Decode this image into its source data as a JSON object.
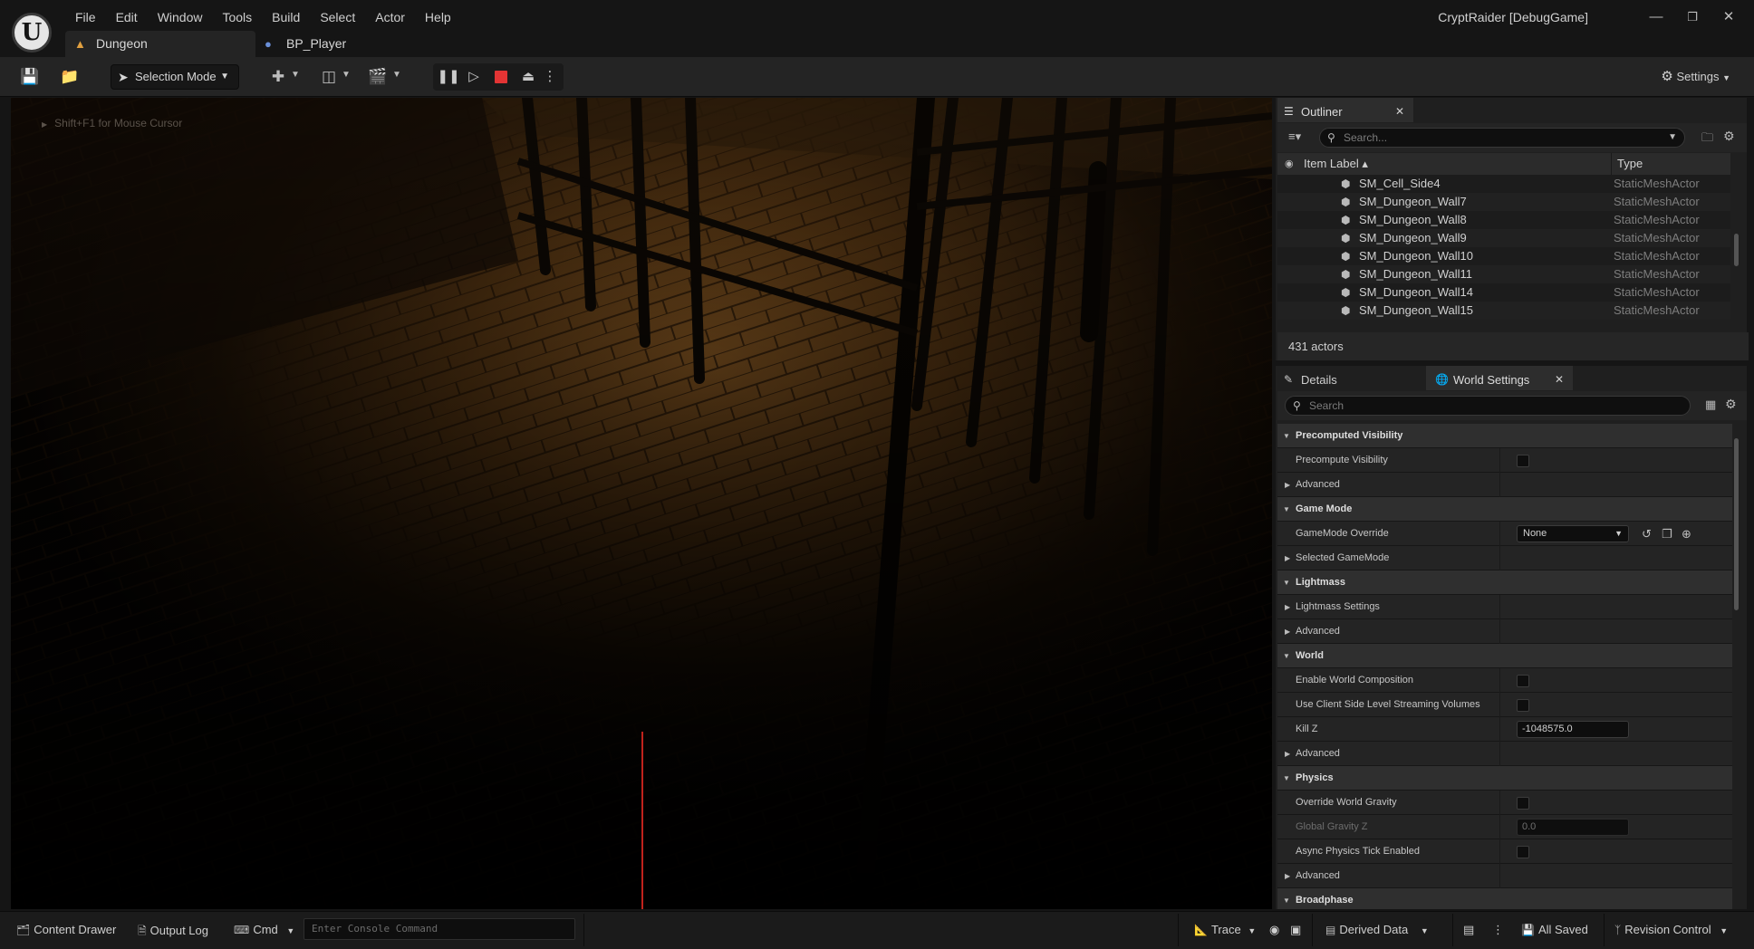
{
  "app": {
    "window_title": "CryptRaider [DebugGame]",
    "logo_glyph": "U"
  },
  "menu": [
    "File",
    "Edit",
    "Window",
    "Tools",
    "Build",
    "Select",
    "Actor",
    "Help"
  ],
  "doc_tabs": [
    {
      "label": "Dungeon",
      "icon": "level-icon",
      "active": true
    },
    {
      "label": "BP_Player",
      "icon": "blueprint-icon",
      "active": false
    }
  ],
  "toolbar": {
    "mode_label": "Selection Mode",
    "settings_label": "Settings"
  },
  "viewport": {
    "hint": "Shift+F1 for Mouse Cursor"
  },
  "outliner": {
    "tab_label": "Outliner",
    "search_placeholder": "Search...",
    "col_label": "Item Label ▴",
    "col_type": "Type",
    "rows": [
      {
        "label": "SM_Cell_Side4",
        "type": "StaticMeshActor"
      },
      {
        "label": "SM_Dungeon_Wall7",
        "type": "StaticMeshActor"
      },
      {
        "label": "SM_Dungeon_Wall8",
        "type": "StaticMeshActor"
      },
      {
        "label": "SM_Dungeon_Wall9",
        "type": "StaticMeshActor"
      },
      {
        "label": "SM_Dungeon_Wall10",
        "type": "StaticMeshActor"
      },
      {
        "label": "SM_Dungeon_Wall11",
        "type": "StaticMeshActor"
      },
      {
        "label": "SM_Dungeon_Wall14",
        "type": "StaticMeshActor"
      },
      {
        "label": "SM_Dungeon_Wall15",
        "type": "StaticMeshActor"
      }
    ],
    "actor_count": "431 actors"
  },
  "details": {
    "tab_details": "Details",
    "tab_world_settings": "World Settings",
    "search_placeholder": "Search",
    "rows": [
      {
        "kind": "cat",
        "label": "Precomputed Visibility"
      },
      {
        "kind": "item",
        "label": "Precompute Visibility",
        "control": "checkbox"
      },
      {
        "kind": "adv",
        "label": "Advanced"
      },
      {
        "kind": "cat",
        "label": "Game Mode"
      },
      {
        "kind": "item",
        "label": "GameMode Override",
        "control": "combo",
        "value": "None"
      },
      {
        "kind": "adv",
        "label": "Selected GameMode"
      },
      {
        "kind": "cat",
        "label": "Lightmass"
      },
      {
        "kind": "adv",
        "label": "Lightmass Settings"
      },
      {
        "kind": "adv",
        "label": "Advanced"
      },
      {
        "kind": "cat",
        "label": "World"
      },
      {
        "kind": "item",
        "label": "Enable World Composition",
        "control": "checkbox"
      },
      {
        "kind": "item",
        "label": "Use Client Side Level Streaming Volumes",
        "control": "checkbox"
      },
      {
        "kind": "item",
        "label": "Kill Z",
        "control": "number",
        "value": "-1048575.0"
      },
      {
        "kind": "adv",
        "label": "Advanced"
      },
      {
        "kind": "cat",
        "label": "Physics"
      },
      {
        "kind": "item",
        "label": "Override World Gravity",
        "control": "checkbox"
      },
      {
        "kind": "item",
        "label": "Global Gravity Z",
        "control": "number",
        "value": "0.0",
        "disabled": true
      },
      {
        "kind": "item",
        "label": "Async Physics Tick Enabled",
        "control": "checkbox"
      },
      {
        "kind": "adv",
        "label": "Advanced"
      },
      {
        "kind": "cat",
        "label": "Broadphase"
      }
    ]
  },
  "statusbar": {
    "content_drawer": "Content Drawer",
    "output_log": "Output Log",
    "cmd": "Cmd",
    "console_placeholder": "Enter Console Command",
    "trace": "Trace",
    "derived_data": "Derived Data",
    "all_saved": "All Saved",
    "revision_control": "Revision Control"
  },
  "colors": {
    "accent_stop": "#e33434",
    "panel_bg": "#1f1f1f",
    "window_bg": "#151515"
  }
}
